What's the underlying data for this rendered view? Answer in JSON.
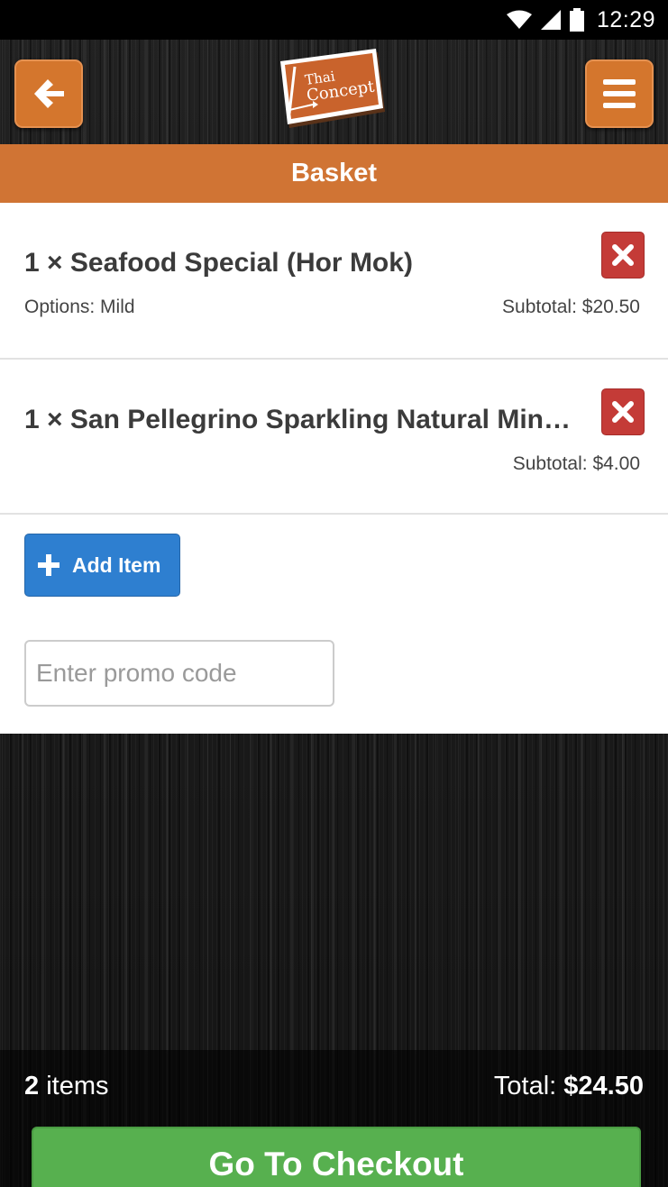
{
  "status_bar": {
    "time": "12:29",
    "icons": [
      "wifi-icon",
      "signal-icon",
      "battery-icon"
    ]
  },
  "header": {
    "back_icon": "arrow-left-icon",
    "menu_icon": "hamburger-menu-icon",
    "logo": {
      "line1": "Thai",
      "line2": "Concept"
    }
  },
  "page": {
    "title": "Basket"
  },
  "basket": {
    "items": [
      {
        "name": "1 × Seafood Special (Hor Mok)",
        "options": "Options: Mild",
        "subtotal": "Subtotal: $20.50"
      },
      {
        "name": "1 × San Pellegrino Sparkling Natural Miner…",
        "options": "",
        "subtotal": "Subtotal: $4.00"
      }
    ]
  },
  "add_item": {
    "label": "Add Item"
  },
  "promo": {
    "placeholder": "Enter promo code",
    "value": ""
  },
  "footer": {
    "count_number": "2",
    "count_label": " items",
    "total_label": "Total: ",
    "total_value": "$24.50",
    "checkout_label": "Go To Checkout"
  },
  "colors": {
    "accent_orange": "#d07434",
    "remove_red": "#c43b37",
    "add_blue": "#2e7fd0",
    "checkout_green": "#57b04f"
  }
}
